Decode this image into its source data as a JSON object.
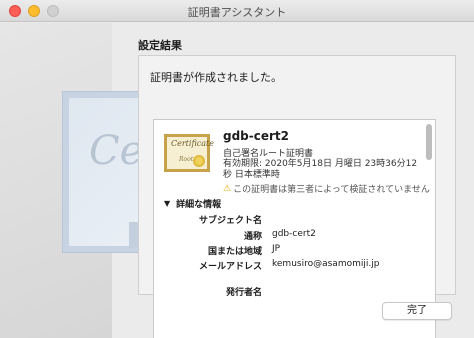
{
  "window": {
    "title": "証明書アシスタント"
  },
  "section_title": "設定結果",
  "panel_message": "証明書が作成されました。",
  "background_art_text": "Cert",
  "certificate": {
    "icon_text": "Certificate",
    "icon_subtext": "Root",
    "name": "gdb-cert2",
    "type": "自己署名ルート証明書",
    "expiry": "有効期限: 2020年5月18日 月曜日 23時36分12秒 日本標準時",
    "warning": "この証明書は第三者によって検証されていません"
  },
  "details": {
    "toggle_label": "詳細な情報",
    "subject_header": "サブジェクト名",
    "fields": [
      {
        "label": "通称",
        "value": "gdb-cert2"
      },
      {
        "label": "国または地域",
        "value": "JP"
      },
      {
        "label": "メールアドレス",
        "value": "kemusiro@asamomiji.jp"
      }
    ],
    "issuer_header": "発行者名"
  },
  "buttons": {
    "done": "完了"
  },
  "icons": {
    "close": "close-icon",
    "minimize": "minimize-icon",
    "maximize": "maximize-icon",
    "warning": "warning-icon",
    "disclosure": "disclosure-triangle-icon",
    "certificate": "certificate-icon"
  }
}
